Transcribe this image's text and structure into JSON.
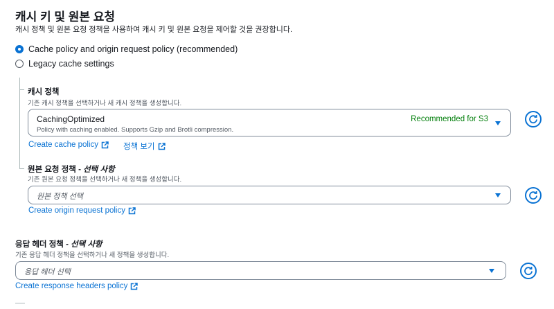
{
  "header": {
    "title": "캐시 키 및 원본 요청",
    "description": "캐시 정책 및 원본 요청 정책을 사용하여 캐시 키 및 원본 요청을 제어할 것을 권장합니다."
  },
  "options": {
    "recommended_label": "Cache policy and origin request policy (recommended)",
    "legacy_label": "Legacy cache settings",
    "selected": "recommended"
  },
  "cache_policy": {
    "title": "캐시 정책",
    "description": "기존 캐시 정책을 선택하거나 새 캐시 정책을 생성합니다.",
    "selected_name": "CachingOptimized",
    "selected_description": "Policy with caching enabled. Supports Gzip and Brotli compression.",
    "badge": "Recommended for S3",
    "create_link": "Create cache policy",
    "view_link": "정책 보기"
  },
  "origin_request_policy": {
    "title_main": "원본 요청 정책 - ",
    "title_optional": "선택 사항",
    "description": "기존 원본 요청 정책을 선택하거나 새 정책을 생성합니다.",
    "placeholder": "원본 정책 선택",
    "create_link": "Create origin request policy"
  },
  "response_headers_policy": {
    "title_main": "응답 헤더 정책 - ",
    "title_optional": "선택 사항",
    "description": "기존 응답 헤더 정책을 선택하거나 새 정책을 생성합니다.",
    "placeholder": "응답 헤더 선택",
    "create_link": "Create response headers policy"
  },
  "colors": {
    "accent": "#0972d3",
    "badge_green": "#037f0c",
    "text": "#16191f",
    "muted": "#545b64"
  },
  "icons": [
    "radio-selected-icon",
    "radio-icon",
    "caret-down-icon",
    "refresh-icon",
    "external-link-icon"
  ]
}
